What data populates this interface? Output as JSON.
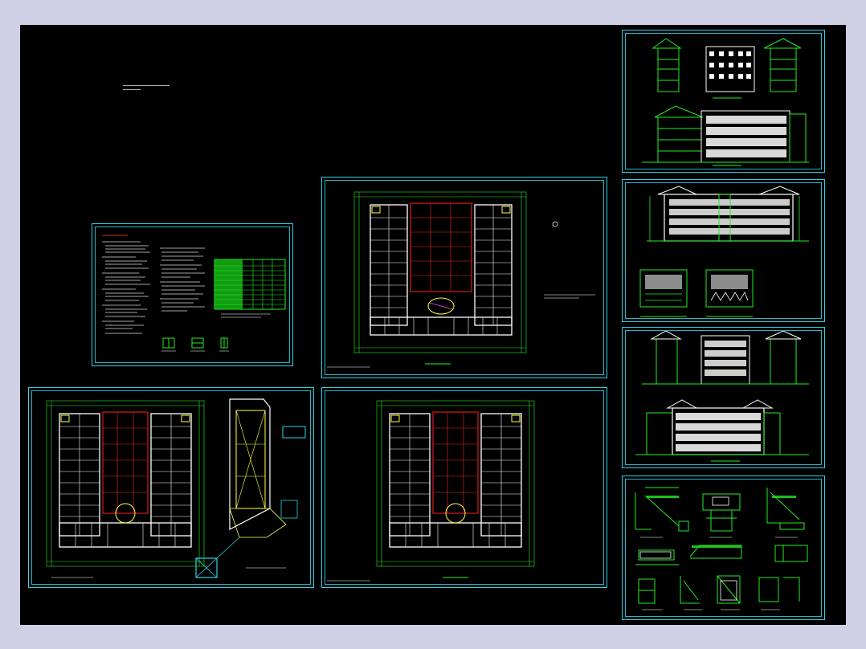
{
  "app": {
    "background": "#cfd0e6",
    "canvas_color": "#000000"
  },
  "colors": {
    "frame": "#2ad4e8",
    "wall": "#ffffff",
    "dimension": "#22ee22",
    "grid_red": "#ff2020",
    "annotation": "#ffff44"
  },
  "drawing": {
    "sheets": [
      {
        "id": "notes-sheet",
        "kind": "design notes and door/window schedule"
      },
      {
        "id": "floor-plan-sheet-main",
        "kind": "typical floor plan"
      },
      {
        "id": "floor-plan-sheet-lower-left",
        "kind": "ground floor plan and roof plan"
      },
      {
        "id": "floor-plan-sheet-lower-mid",
        "kind": "upper floor plan"
      },
      {
        "id": "elevation-sheet-1",
        "kind": "elevations"
      },
      {
        "id": "elevation-sheet-2",
        "kind": "elevation and sections"
      },
      {
        "id": "elevation-sheet-3",
        "kind": "elevations"
      },
      {
        "id": "detail-sheet",
        "kind": "construction details"
      }
    ]
  }
}
